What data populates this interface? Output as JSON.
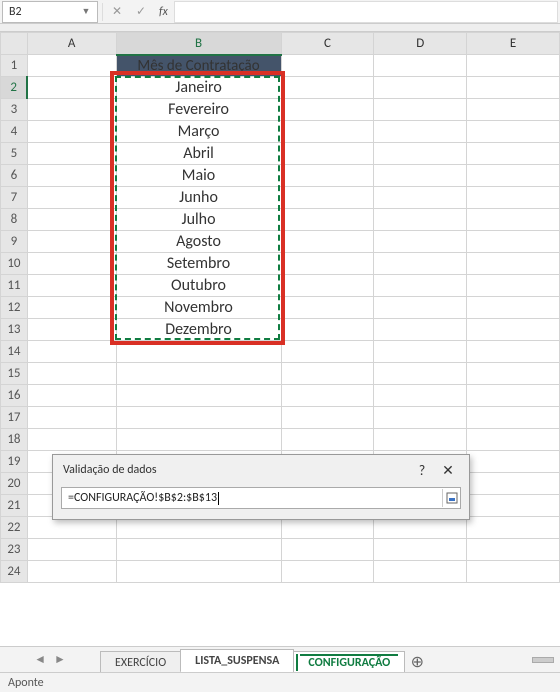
{
  "formula_bar": {
    "name_box": "B2",
    "cancel": "✕",
    "enter": "✓",
    "fx": "fx",
    "formula": ""
  },
  "columns": [
    "A",
    "B",
    "C",
    "D",
    "E"
  ],
  "rows": [
    "1",
    "2",
    "3",
    "4",
    "5",
    "6",
    "7",
    "8",
    "9",
    "10",
    "11",
    "12",
    "13",
    "14",
    "15",
    "16",
    "17",
    "18",
    "19",
    "20",
    "21",
    "22",
    "23",
    "24"
  ],
  "header_cell": "Mês de Contratação",
  "months": [
    "Janeiro",
    "Fevereiro",
    "Março",
    "Abril",
    "Maio",
    "Junho",
    "Julho",
    "Agosto",
    "Setembro",
    "Outubro",
    "Novembro",
    "Dezembro"
  ],
  "dialog": {
    "title": "Validação de dados",
    "help": "?",
    "close": "✕",
    "formula": "=CONFIGURAÇÃO!$B$2:$B$13"
  },
  "tabs": {
    "t1": "EXERCÍCIO",
    "t2": "LISTA_SUSPENSA",
    "t3": "CONFIGURAÇÃO",
    "add": "⊕"
  },
  "status": "Aponte"
}
